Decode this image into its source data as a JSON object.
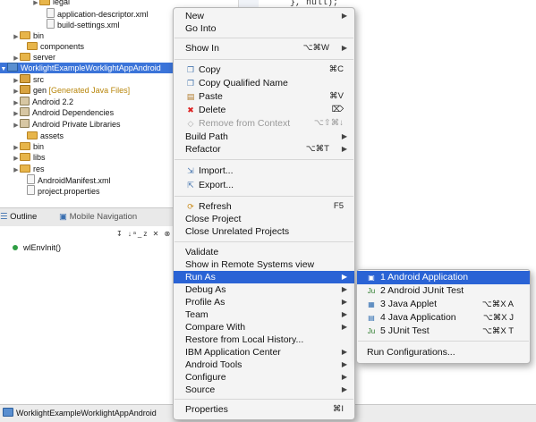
{
  "editor": {
    "code_text": "}, null);"
  },
  "tree": {
    "rows": [
      {
        "label": "legal",
        "decor": ""
      },
      {
        "label": "application-descriptor.xml",
        "decor": ""
      },
      {
        "label": "build-settings.xml",
        "decor": ""
      },
      {
        "label": "bin",
        "decor": ""
      },
      {
        "label": "components",
        "decor": ""
      },
      {
        "label": "server",
        "decor": ""
      },
      {
        "label": "WorklightExampleWorklightAppAndroid",
        "decor": ""
      },
      {
        "label": "src",
        "decor": ""
      },
      {
        "label": "gen",
        "decor": "[Generated Java Files]"
      },
      {
        "label": "Android 2.2",
        "decor": ""
      },
      {
        "label": "Android Dependencies",
        "decor": ""
      },
      {
        "label": "Android Private Libraries",
        "decor": ""
      },
      {
        "label": "assets",
        "decor": ""
      },
      {
        "label": "bin",
        "decor": ""
      },
      {
        "label": "libs",
        "decor": ""
      },
      {
        "label": "res",
        "decor": ""
      },
      {
        "label": "AndroidManifest.xml",
        "decor": ""
      },
      {
        "label": "project.properties",
        "decor": ""
      }
    ]
  },
  "outline": {
    "tabs": {
      "outline": "Outline",
      "mobile_navigation": "Mobile Navigation"
    },
    "toolbar_glyphs": "↧ ↓ᵃ_z ✕ ⊗ ◦ ▿",
    "item": "wlEnvInit()"
  },
  "status_bar": {
    "text": "WorklightExampleWorklightAppAndroid"
  },
  "context_menu": {
    "items": [
      {
        "label": "New",
        "shortcut": ""
      },
      {
        "label": "Go Into",
        "shortcut": ""
      },
      {
        "label": "Show In",
        "shortcut": "⌥⌘W"
      },
      {
        "label": "Copy",
        "shortcut": "⌘C"
      },
      {
        "label": "Copy Qualified Name",
        "shortcut": ""
      },
      {
        "label": "Paste",
        "shortcut": "⌘V"
      },
      {
        "label": "Delete",
        "shortcut": "⌦"
      },
      {
        "label": "Remove from Context",
        "shortcut": "⌥⇧⌘↓"
      },
      {
        "label": "Build Path",
        "shortcut": ""
      },
      {
        "label": "Refactor",
        "shortcut": "⌥⌘T"
      },
      {
        "label": "Import...",
        "shortcut": ""
      },
      {
        "label": "Export...",
        "shortcut": ""
      },
      {
        "label": "Refresh",
        "shortcut": "F5"
      },
      {
        "label": "Close Project",
        "shortcut": ""
      },
      {
        "label": "Close Unrelated Projects",
        "shortcut": ""
      },
      {
        "label": "Validate",
        "shortcut": ""
      },
      {
        "label": "Show in Remote Systems view",
        "shortcut": ""
      },
      {
        "label": "Run As",
        "shortcut": ""
      },
      {
        "label": "Debug As",
        "shortcut": ""
      },
      {
        "label": "Profile As",
        "shortcut": ""
      },
      {
        "label": "Team",
        "shortcut": ""
      },
      {
        "label": "Compare With",
        "shortcut": ""
      },
      {
        "label": "Restore from Local History...",
        "shortcut": ""
      },
      {
        "label": "IBM Application Center",
        "shortcut": ""
      },
      {
        "label": "Android Tools",
        "shortcut": ""
      },
      {
        "label": "Configure",
        "shortcut": ""
      },
      {
        "label": "Source",
        "shortcut": ""
      },
      {
        "label": "Properties",
        "shortcut": "⌘I"
      }
    ]
  },
  "run_as_submenu": {
    "items": [
      {
        "label": "1 Android Application",
        "shortcut": ""
      },
      {
        "label": "2 Android JUnit Test",
        "shortcut": ""
      },
      {
        "label": "3 Java Applet",
        "shortcut": "⌥⌘X A"
      },
      {
        "label": "4 Java Application",
        "shortcut": "⌥⌘X J"
      },
      {
        "label": "5 JUnit Test",
        "shortcut": "⌥⌘X T"
      },
      {
        "label": "Run Configurations...",
        "shortcut": ""
      }
    ]
  },
  "colors": {
    "selection": "#2a63d5",
    "tree_selection": "#3b74d9",
    "decoration": "#b8860b"
  }
}
